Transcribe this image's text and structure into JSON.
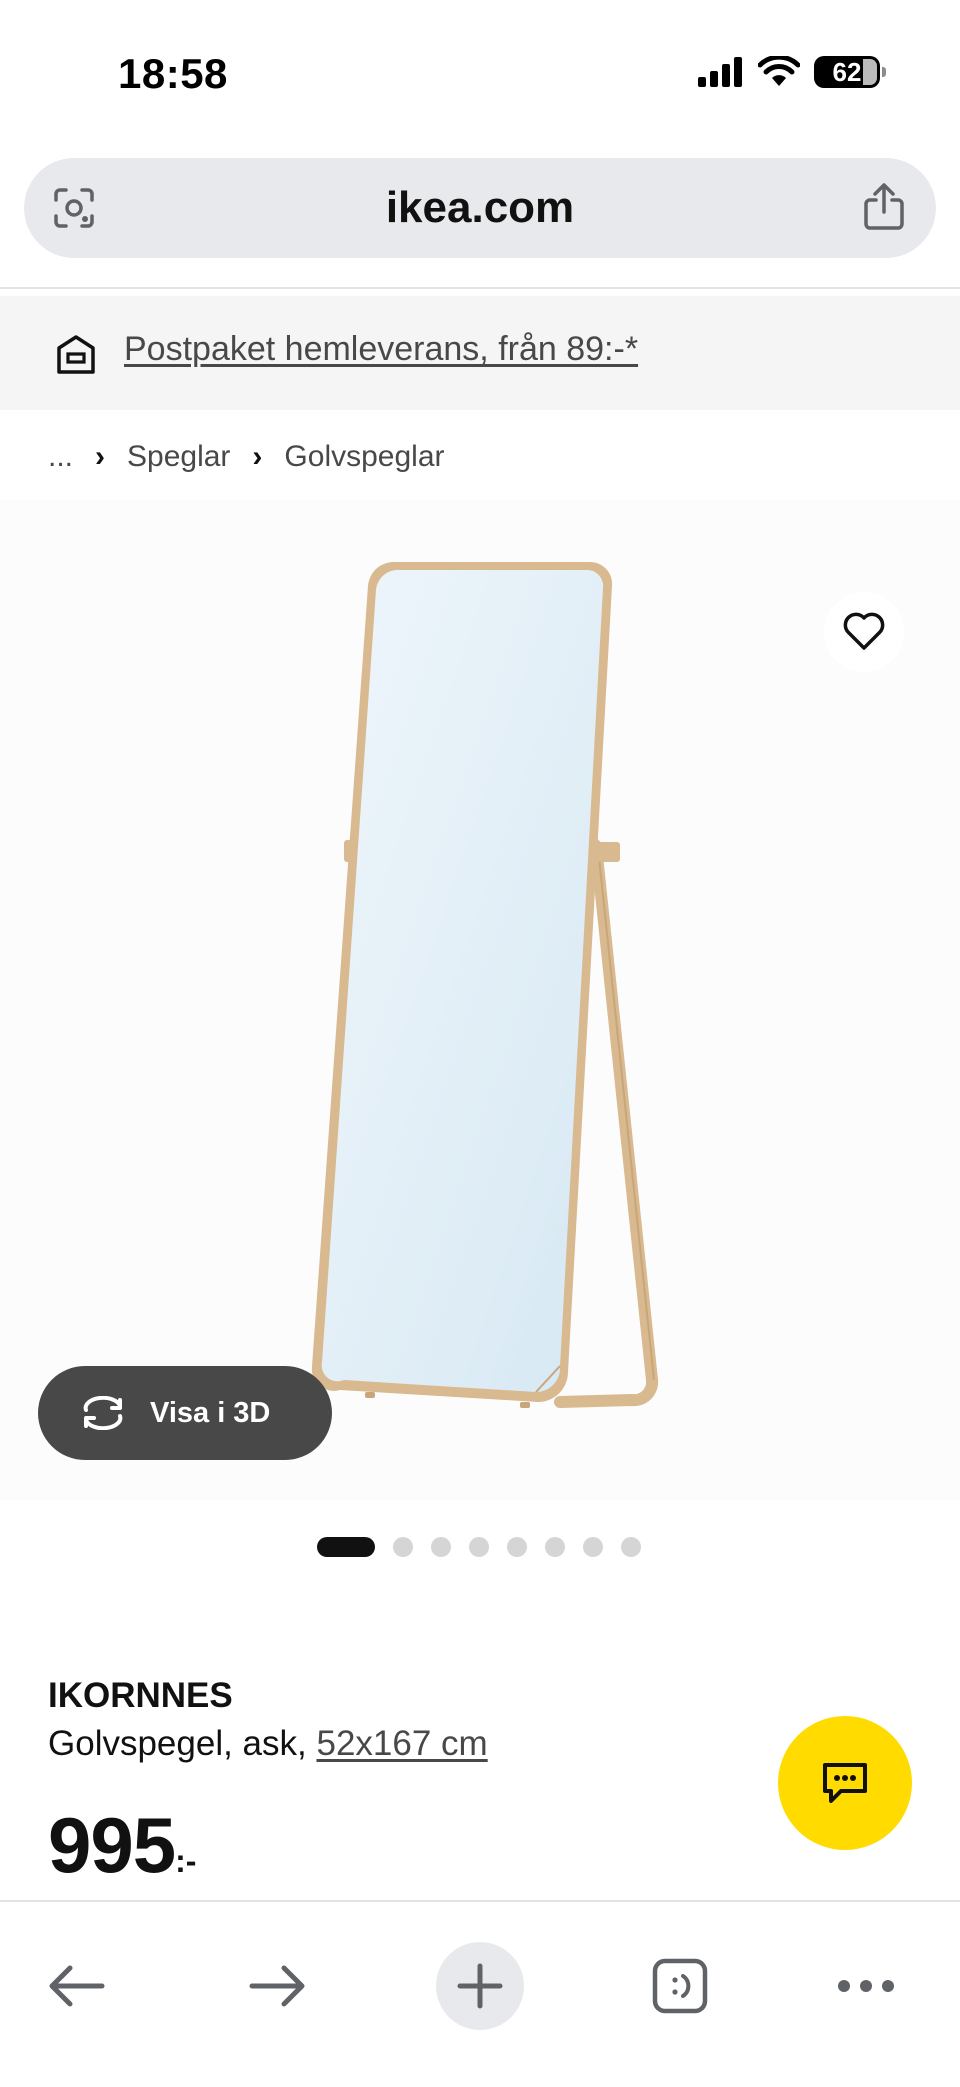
{
  "status_bar": {
    "time": "18:58",
    "battery": "62"
  },
  "browser": {
    "url": "ikea.com"
  },
  "banner": {
    "delivery_text": "Postpaket hemleverans, från 89:-*"
  },
  "breadcrumb": {
    "ellipsis": "...",
    "items": [
      "Speglar",
      "Golvspeglar"
    ]
  },
  "gallery": {
    "view_3d_label": "Visa i 3D",
    "slide_count": 8,
    "active_slide": 1
  },
  "product": {
    "name": "IKORNNES",
    "description": "Golvspegel, ask,",
    "size": "52x167 cm",
    "price": "995",
    "price_suffix": ":-"
  },
  "colors": {
    "ikea_yellow": "#ffdb00",
    "text": "#111111",
    "banner_bg": "#f5f5f5",
    "url_bar_bg": "#e7e9ec"
  },
  "icons": [
    "lens-icon",
    "share-icon",
    "delivery-box-icon",
    "heart-icon",
    "rotate-3d-icon",
    "chat-icon",
    "back-arrow-icon",
    "forward-arrow-icon",
    "plus-icon",
    "tabs-icon",
    "more-icon"
  ]
}
